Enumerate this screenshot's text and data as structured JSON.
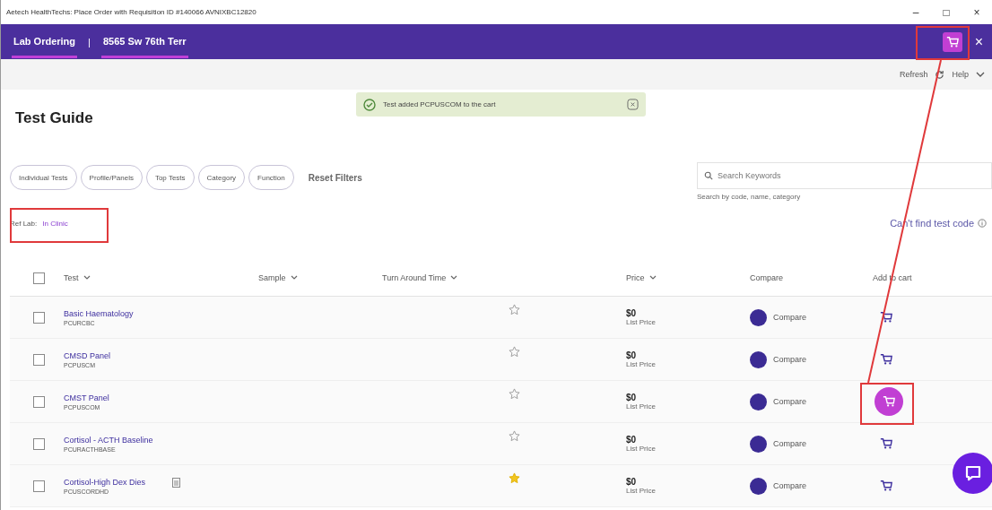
{
  "window": {
    "title": "Aetech HealthTechs: Place Order with Requisition ID #140066 AVNIXBC12820",
    "controls": [
      "–",
      "□",
      "×"
    ]
  },
  "nav": {
    "items": [
      {
        "label": "Lab Ordering",
        "selected": true
      },
      {
        "label": "8565 Sw 76th Terr",
        "selected": true
      }
    ],
    "separator": "|",
    "close": "×"
  },
  "toolbar": {
    "refresh": "Refresh",
    "help": "Help"
  },
  "toast": {
    "message": "Test added PCPUSCOM to the cart"
  },
  "page_title": "Test Guide",
  "filters": [
    "Individual Tests",
    "Profile/Panels",
    "Top Tests",
    "Category",
    "Function"
  ],
  "reset_filters": "Reset Filters",
  "search": {
    "placeholder": "Search Keywords",
    "hint": "Search by code, name, category"
  },
  "ref_lab": {
    "label": "Ref Lab:",
    "value": "In Clinic"
  },
  "cant_find": "Can't find test code",
  "table": {
    "all_checked": false,
    "columns": [
      {
        "label": "Test",
        "sortable": true
      },
      {
        "label": "Sample",
        "sortable": true
      },
      {
        "label": "Turn Around Time",
        "sortable": true
      },
      {
        "label": "Price",
        "sortable": true
      },
      {
        "label": "Compare",
        "sortable": false
      },
      {
        "label": "Add to cart",
        "sortable": false
      }
    ],
    "rows": [
      {
        "checked": false,
        "name": "Basic Haematology",
        "code": "PCURCBC",
        "note": false,
        "favorite": false,
        "price": "$0",
        "price_label": "List Price",
        "compare": "Compare",
        "in_cart": false
      },
      {
        "checked": false,
        "name": "CMSD Panel",
        "code": "PCPUSCM",
        "note": false,
        "favorite": false,
        "price": "$0",
        "price_label": "List Price",
        "compare": "Compare",
        "in_cart": false
      },
      {
        "checked": false,
        "name": "CMST Panel",
        "code": "PCPUSCOM",
        "note": false,
        "favorite": false,
        "price": "$0",
        "price_label": "List Price",
        "compare": "Compare",
        "in_cart": true
      },
      {
        "checked": false,
        "name": "Cortisol - ACTH Baseline",
        "code": "PCURACTHBASE",
        "note": false,
        "favorite": false,
        "price": "$0",
        "price_label": "List Price",
        "compare": "Compare",
        "in_cart": false
      },
      {
        "checked": false,
        "name": "Cortisol-High Dex Dies",
        "code": "PCUSCORDHD",
        "note": true,
        "favorite": true,
        "price": "$0",
        "price_label": "List Price",
        "compare": "Compare",
        "in_cart": false
      }
    ]
  }
}
